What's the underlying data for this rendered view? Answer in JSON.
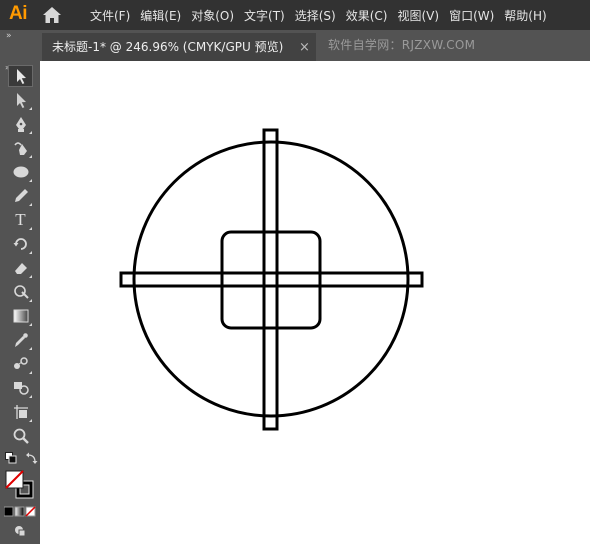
{
  "app": {
    "logo": "Ai"
  },
  "menu": {
    "items": [
      "文件(F)",
      "编辑(E)",
      "对象(O)",
      "文字(T)",
      "选择(S)",
      "效果(C)",
      "视图(V)",
      "窗口(W)",
      "帮助(H)"
    ]
  },
  "tabs": {
    "active_label": "未标题-1* @ 246.96% (CMYK/GPU 预览)",
    "close_glyph": "×",
    "watermark": "软件自学网：RJZXW.COM"
  },
  "toolbar": {
    "collapse_glyph": "»",
    "tools": [
      {
        "name": "selection-tool",
        "icon": "black-arrow-icon",
        "selected": true
      },
      {
        "name": "direct-selection-tool",
        "icon": "white-arrow-icon"
      },
      {
        "name": "pen-tool",
        "icon": "pen-icon"
      },
      {
        "name": "curvature-tool",
        "icon": "curvature-pen-icon"
      },
      {
        "name": "ellipse-tool",
        "icon": "ellipse-icon"
      },
      {
        "name": "pencil-tool",
        "icon": "pencil-icon"
      },
      {
        "name": "type-tool",
        "icon": "type-icon",
        "glyph": "T"
      },
      {
        "name": "rotate-tool",
        "icon": "rotate-icon"
      },
      {
        "name": "eraser-tool",
        "icon": "eraser-icon"
      },
      {
        "name": "puppet-warp-tool",
        "icon": "puppet-warp-icon"
      },
      {
        "name": "gradient-tool",
        "icon": "gradient-icon"
      },
      {
        "name": "eyedropper-tool",
        "icon": "eyedropper-icon"
      },
      {
        "name": "blend-tool",
        "icon": "blend-icon"
      },
      {
        "name": "shape-builder-tool",
        "icon": "shape-builder-icon"
      },
      {
        "name": "artboard-tool",
        "icon": "artboard-icon"
      },
      {
        "name": "zoom-tool",
        "icon": "zoom-icon"
      }
    ]
  },
  "colors": {
    "menubar_bg": "#323232",
    "panel_bg": "#535353",
    "logo": "#FF9A00",
    "fill": "none",
    "stroke": "#000000"
  },
  "canvas": {
    "artwork": "circle-with-crosshair-and-rounded-square"
  }
}
